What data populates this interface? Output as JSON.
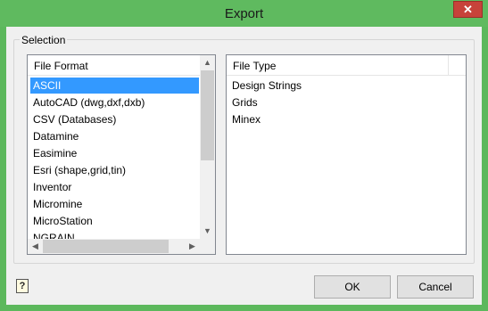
{
  "window": {
    "title": "Export",
    "close_glyph": "✕"
  },
  "selection_group": {
    "label": "Selection"
  },
  "file_format_list": {
    "header": "File Format",
    "items": [
      "ASCII",
      "AutoCAD (dwg,dxf,dxb)",
      "CSV (Databases)",
      "Datamine",
      "Easimine",
      "Esri (shape,grid,tin)",
      "Inventor",
      "Micromine",
      "MicroStation",
      "NGRAIN"
    ],
    "selected": "ASCII"
  },
  "file_type_list": {
    "header": "File Type",
    "items": [
      "Design Strings",
      "Grids",
      "Minex"
    ]
  },
  "buttons": {
    "ok": "OK",
    "cancel": "Cancel"
  },
  "help": {
    "glyph": "?"
  },
  "scroll_glyphs": {
    "up": "▲",
    "down": "▼",
    "left": "◀",
    "right": "▶"
  },
  "colors": {
    "title_bar": "#5fba5f",
    "selected_row": "#3399ff",
    "close_button": "#c7423a"
  }
}
